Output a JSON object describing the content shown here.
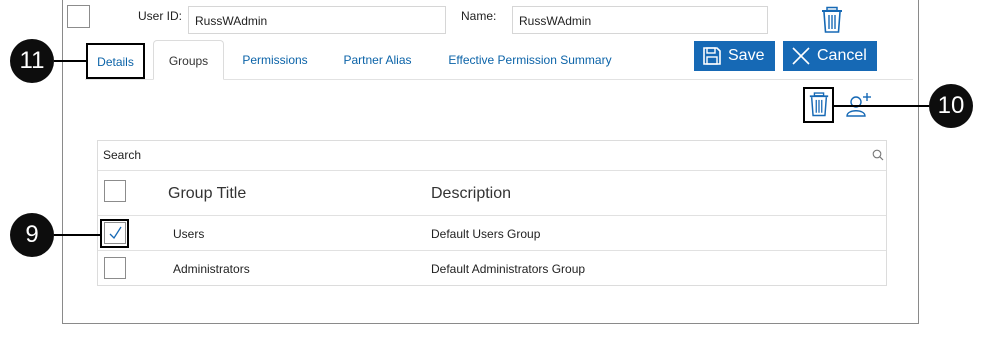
{
  "header": {
    "user_id_label": "User ID:",
    "user_id_value": "RussWAdmin",
    "name_label": "Name:",
    "name_value": "RussWAdmin"
  },
  "tabs": [
    {
      "label": "Details"
    },
    {
      "label": "Groups"
    },
    {
      "label": "Permissions"
    },
    {
      "label": "Partner Alias"
    },
    {
      "label": "Effective Permission Summary"
    }
  ],
  "buttons": {
    "save_label": "Save",
    "cancel_label": "Cancel"
  },
  "search": {
    "label": "Search"
  },
  "table": {
    "columns": [
      "Group Title",
      "Description"
    ],
    "rows": [
      {
        "title": "Users",
        "description": "Default Users Group",
        "checked": true
      },
      {
        "title": "Administrators",
        "description": "Default Administrators Group",
        "checked": false
      }
    ]
  },
  "callouts": {
    "c9": "9",
    "c10": "10",
    "c11": "11"
  },
  "colors": {
    "accent": "#1669b5",
    "link": "#0b63a8"
  },
  "icons": [
    "trash-icon",
    "save-disk-icon",
    "close-x-icon",
    "add-user-icon",
    "search-icon",
    "checkmark-icon"
  ]
}
